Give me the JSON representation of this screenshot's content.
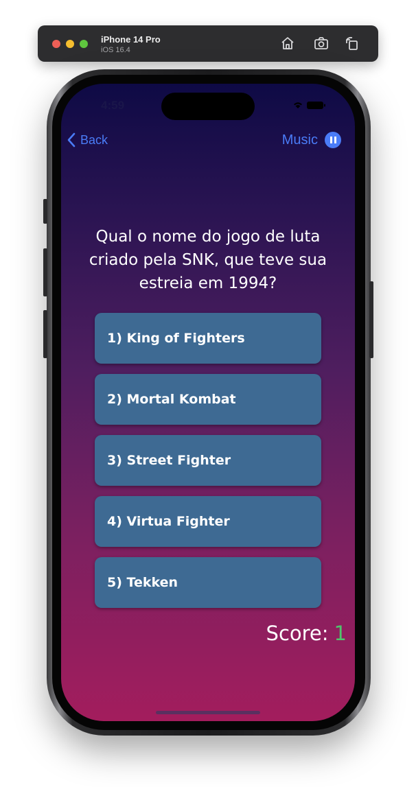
{
  "simulator": {
    "device_name": "iPhone 14 Pro",
    "os_version": "iOS 16.4",
    "toolbar_icons": [
      "home-icon",
      "screenshot-icon",
      "rotate-icon"
    ]
  },
  "status_bar": {
    "time": "4:59"
  },
  "nav": {
    "back_label": "Back",
    "music_label": "Music"
  },
  "quiz": {
    "question": "Qual o nome do jogo de luta criado pela SNK, que teve sua estreia em 1994?",
    "answers": [
      "1) King of Fighters",
      "2) Mortal Kombat",
      "3) Street Fighter",
      "4) Virtua Fighter",
      "5) Tekken"
    ],
    "score_label": "Score:",
    "score_value": "1"
  },
  "colors": {
    "accent": "#4a7cf7",
    "answer_bg": "#3e6a93",
    "score_value": "#4fc36b",
    "gradient_top": "#0e0a45",
    "gradient_bottom": "#a31d5d"
  }
}
